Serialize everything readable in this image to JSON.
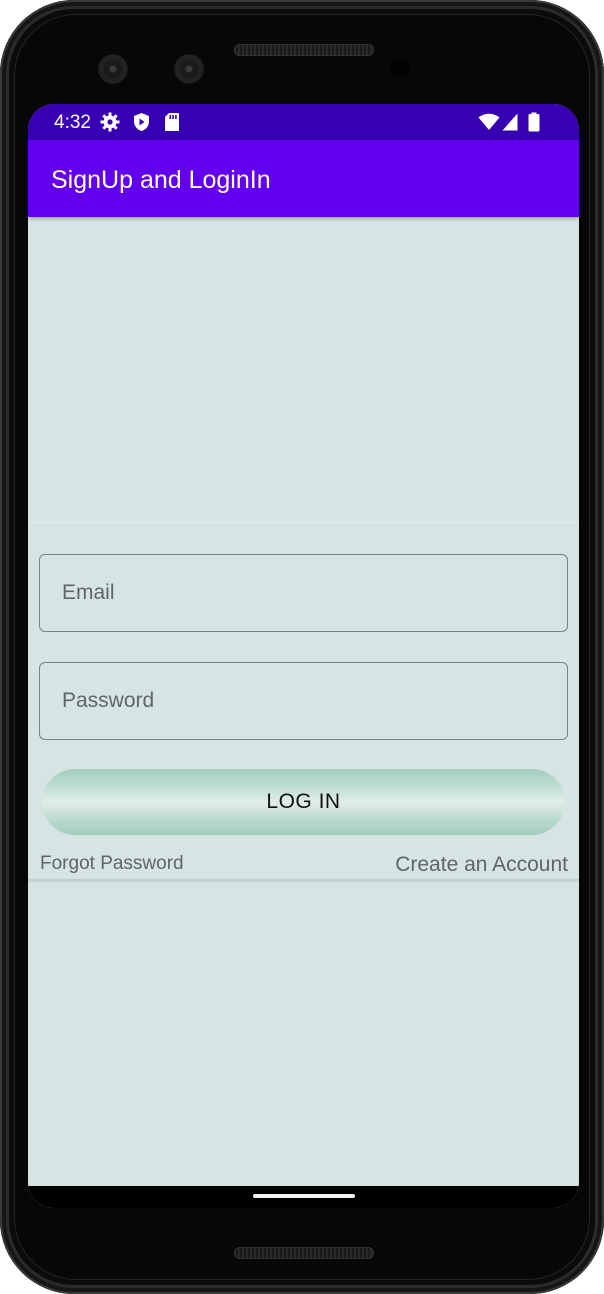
{
  "status_bar": {
    "time": "4:32",
    "left_icons": [
      "gear-icon",
      "shield-icon",
      "sd-card-icon"
    ],
    "right_icons": [
      "wifi-icon",
      "signal-icon",
      "battery-icon"
    ],
    "color": "#3700b3"
  },
  "app_bar": {
    "title": "SignUp and LoginIn",
    "color": "#6200ee"
  },
  "form": {
    "email_placeholder": "Email",
    "email_value": "",
    "password_placeholder": "Password",
    "password_value": "",
    "login_label": "LOG IN",
    "forgot_label": "Forgot Password",
    "create_label": "Create an Account"
  },
  "theme": {
    "background": "#d6e4e4",
    "button_gradient": [
      "#a2cdbd",
      "#e2ecea"
    ]
  }
}
